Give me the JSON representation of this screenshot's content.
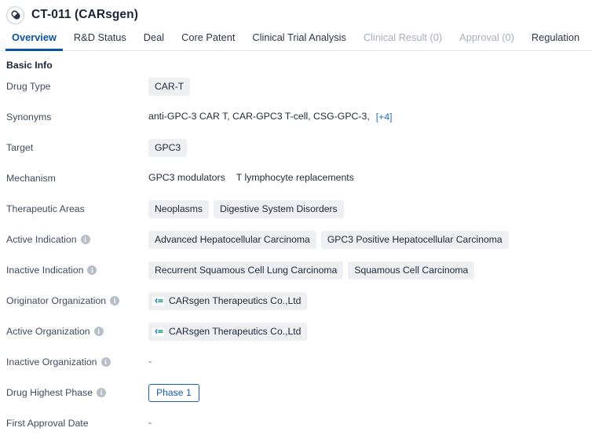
{
  "header": {
    "icon": "pill-capsule-icon",
    "title": "CT-011 (CARsgen)"
  },
  "tabs": [
    {
      "label": "Overview",
      "state": "active"
    },
    {
      "label": "R&D Status",
      "state": "normal"
    },
    {
      "label": "Deal",
      "state": "normal"
    },
    {
      "label": "Core Patent",
      "state": "normal"
    },
    {
      "label": "Clinical Trial Analysis",
      "state": "normal"
    },
    {
      "label": "Clinical Result (0)",
      "state": "disabled"
    },
    {
      "label": "Approval (0)",
      "state": "disabled"
    },
    {
      "label": "Regulation",
      "state": "normal"
    }
  ],
  "section": {
    "title": "Basic Info"
  },
  "rows": {
    "drug_type": {
      "label": "Drug Type",
      "values": [
        "CAR-T"
      ]
    },
    "synonyms": {
      "label": "Synonyms",
      "text": "anti-GPC-3 CAR T,  CAR-GPC3 T-cell,  CSG-GPC-3,",
      "more_link": "[+4]"
    },
    "target": {
      "label": "Target",
      "values": [
        "GPC3"
      ]
    },
    "mechanism": {
      "label": "Mechanism",
      "values": [
        "GPC3 modulators",
        "T lymphocyte replacements"
      ]
    },
    "therapeutic_areas": {
      "label": "Therapeutic Areas",
      "values": [
        "Neoplasms",
        "Digestive System Disorders"
      ]
    },
    "active_indication": {
      "label": "Active Indication",
      "has_info": true,
      "values": [
        "Advanced Hepatocellular Carcinoma",
        "GPC3 Positive Hepatocellular Carcinoma"
      ]
    },
    "inactive_indication": {
      "label": "Inactive Indication",
      "has_info": true,
      "values": [
        "Recurrent Squamous Cell Lung Carcinoma",
        "Squamous Cell Carcinoma"
      ]
    },
    "originator_organization": {
      "label": "Originator Organization",
      "has_info": true,
      "values": [
        "CARsgen Therapeutics Co.,Ltd"
      ]
    },
    "active_organization": {
      "label": "Active Organization",
      "has_info": true,
      "values": [
        "CARsgen Therapeutics Co.,Ltd"
      ]
    },
    "inactive_organization": {
      "label": "Inactive Organization",
      "has_info": true,
      "empty_value": "-"
    },
    "drug_highest_phase": {
      "label": "Drug Highest Phase",
      "has_info": true,
      "badge": "Phase 1"
    },
    "first_approval_date": {
      "label": "First Approval Date",
      "empty_value": "-"
    }
  },
  "colors": {
    "accent_blue": "#0a53a8",
    "link_blue": "#2170c9",
    "chip_bg": "#edeff3",
    "label_text": "#3f4a5f",
    "info_icon_gray": "#b9bfc9"
  },
  "info_icon_glyph": "i"
}
